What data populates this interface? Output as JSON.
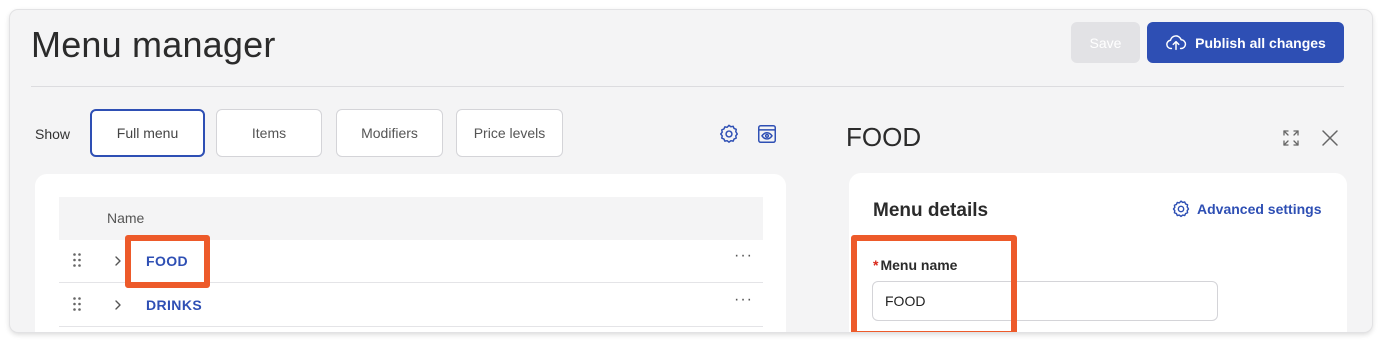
{
  "page": {
    "title": "Menu manager"
  },
  "toolbar": {
    "save_label": "Save",
    "publish_label": "Publish all changes"
  },
  "filters": {
    "show_label": "Show",
    "options": [
      "Full menu",
      "Items",
      "Modifiers",
      "Price levels"
    ],
    "selected": "Full menu"
  },
  "table": {
    "column_name": "Name",
    "rows": [
      {
        "name": "FOOD"
      },
      {
        "name": "DRINKS"
      }
    ],
    "more_label": "···"
  },
  "detail": {
    "title": "FOOD",
    "section_title": "Menu details",
    "advanced_settings_label": "Advanced settings",
    "menu_name_label": "Menu name",
    "required_marker": "*",
    "menu_name_value": "FOOD"
  },
  "colors": {
    "accent": "#2e4fb4",
    "highlight": "#ed5a2a",
    "required": "#d9291c"
  }
}
